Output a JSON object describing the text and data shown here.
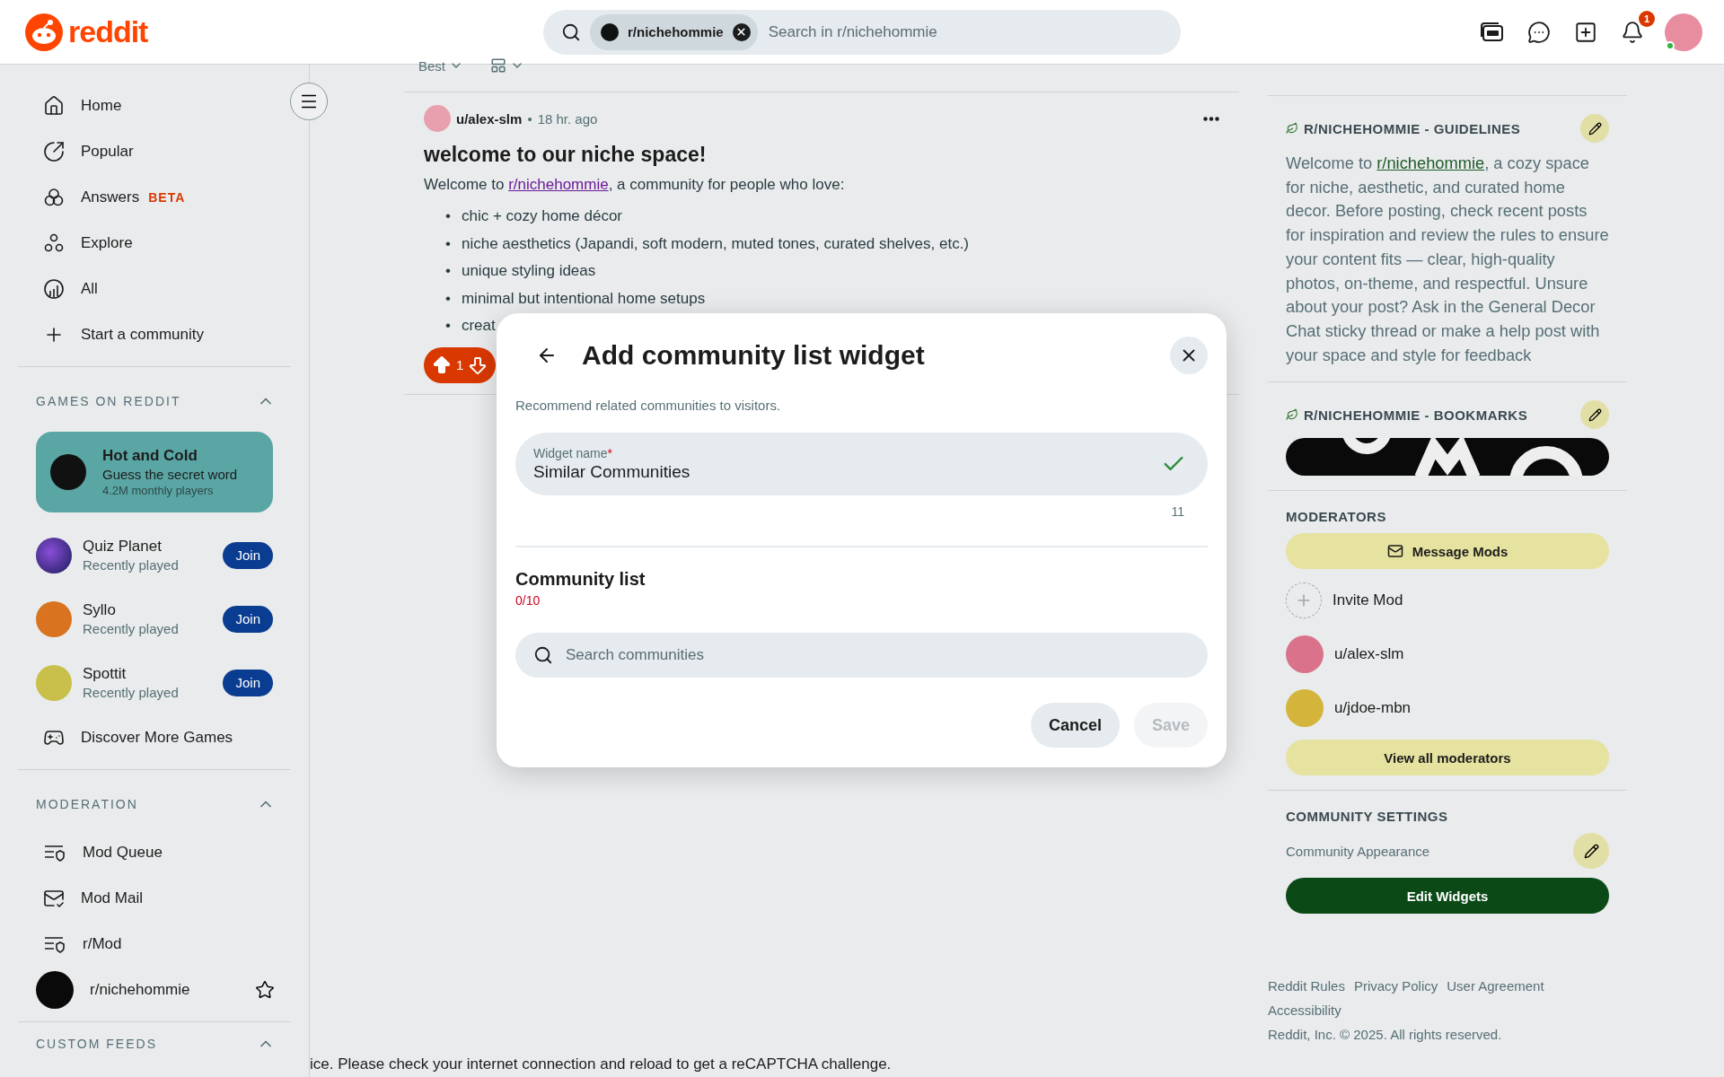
{
  "header": {
    "logo_text": "reddit",
    "search": {
      "chip": "r/nichehommie",
      "placeholder": "Search in r/nichehommie"
    },
    "notifications_badge": "1"
  },
  "sidebar": {
    "nav": [
      {
        "label": "Home",
        "kind": "home"
      },
      {
        "label": "Popular",
        "kind": "popular"
      },
      {
        "label": "Answers",
        "kind": "answers",
        "badge": "BETA"
      },
      {
        "label": "Explore",
        "kind": "explore"
      },
      {
        "label": "All",
        "kind": "all"
      },
      {
        "label": "Start a community",
        "kind": "plus"
      }
    ],
    "games": {
      "title": "GAMES ON REDDIT",
      "expanded": true,
      "featured": {
        "name": "Hot and Cold",
        "tagline": "Guess the secret word",
        "players": "4.2M monthly players"
      },
      "items": [
        {
          "name": "Quiz Planet",
          "status": "Recently played",
          "action": "Join",
          "kind": "quiz"
        },
        {
          "name": "Syllo",
          "status": "Recently played",
          "action": "Join",
          "kind": "syllo"
        },
        {
          "name": "Spottit",
          "status": "Recently played",
          "action": "Join",
          "kind": "spottit"
        }
      ],
      "discover": "Discover More Games"
    },
    "moderation": {
      "title": "MODERATION",
      "expanded": true,
      "items": [
        {
          "label": "Mod Queue",
          "kind": "queue"
        },
        {
          "label": "Mod Mail",
          "kind": "mail"
        },
        {
          "label": "r/Mod",
          "kind": "queue"
        },
        {
          "label": "r/nichehommie",
          "kind": "community",
          "starred": false
        }
      ]
    },
    "custom_feeds": {
      "title": "CUSTOM FEEDS",
      "expanded": true
    }
  },
  "feed": {
    "sort": "Best",
    "post": {
      "author": "u/alex-slm",
      "separator": "•",
      "time": "18 hr. ago",
      "bullet_marker": "•",
      "title": "welcome to our niche space!",
      "intro": {
        "before": "Welcome to ",
        "link": "r/nichehommie",
        "after": ", a community for people who love:"
      },
      "bullets": [
        "chic + cozy home décor",
        "niche aesthetics (Japandi, soft modern, muted tones, curated shelves, etc.)",
        "unique styling ideas",
        "minimal but intentional home setups",
        "creat"
      ],
      "votes": "1"
    }
  },
  "modal": {
    "title": "Add community list widget",
    "subtitle": "Recommend related communities to visitors.",
    "name_field": {
      "label": "Widget name",
      "required_mark": "*",
      "value": "Similar Communities",
      "valid": true,
      "counter": "11"
    },
    "list": {
      "title": "Community list",
      "count": "0/10",
      "search_placeholder": "Search communities"
    },
    "buttons": [
      {
        "label": "Cancel",
        "disabled": false
      },
      {
        "label": "Save",
        "disabled": true
      }
    ]
  },
  "right": {
    "guidelines": {
      "title": "R/NICHEHOMMIE - GUIDELINES",
      "text": {
        "before": "Welcome to ",
        "link": "r/nichehommie",
        "after": ", a cozy space for niche, aesthetic, and curated home decor. Before posting, check recent posts for inspiration and review the rules to ensure your content fits — clear, high-quality photos, on-theme, and respectful. Unsure about your post? Ask in the General Decor Chat sticky thread or make a help post with your space and style for feedback"
      }
    },
    "bookmarks": {
      "title": "R/NICHEHOMMIE - BOOKMARKS"
    },
    "moderators": {
      "title": "MODERATORS",
      "message": "Message Mods",
      "invite": "Invite Mod",
      "mods": [
        {
          "name": "u/alex-slm",
          "color": "#d9728a"
        },
        {
          "name": "u/jdoe-mbn",
          "color": "#d4b43a"
        }
      ],
      "view_all": "View all moderators"
    },
    "settings": {
      "title": "COMMUNITY SETTINGS",
      "appearance": "Community Appearance",
      "edit_widgets": "Edit Widgets"
    },
    "footer": {
      "links": [
        "Reddit Rules",
        "Privacy Policy",
        "User Agreement",
        "Accessibility"
      ],
      "copyright": "Reddit, Inc. © 2025. All rights reserved."
    }
  },
  "notice": "ice. Please check your internet connection and reload to get a reCAPTCHA challenge."
}
